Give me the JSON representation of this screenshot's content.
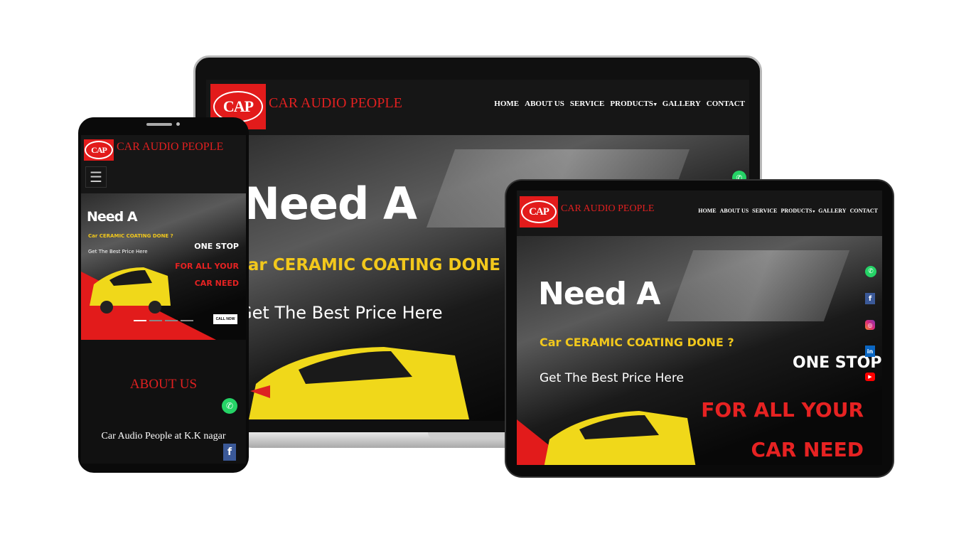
{
  "brand": {
    "name": "CAR AUDIO PEOPLE",
    "logo_text": "CAP"
  },
  "nav": {
    "items": [
      "HOME",
      "ABOUT US",
      "SERVICE",
      "PRODUCTS",
      "GALLERY",
      "CONTACT"
    ],
    "dropdown_item": "PRODUCTS"
  },
  "hero": {
    "headline": "Need A",
    "subtitle": "Car CERAMIC COATING DONE ?",
    "cta_text": "Get The Best Price Here",
    "side_top": "ONE STOP",
    "side_line1": "FOR ALL YOUR",
    "side_line2": "CAR NEED",
    "button": "CALL NOW"
  },
  "about": {
    "heading": "ABOUT US",
    "text": "Car Audio People at K.K nagar"
  },
  "social": [
    "whatsapp-icon",
    "facebook-icon",
    "instagram-icon",
    "linkedin-icon",
    "youtube-icon"
  ],
  "colors": {
    "brand_red": "#e21b1b",
    "accent_yellow": "#f2c81c",
    "dark_bg": "#0b0b0b",
    "header_bg": "#161616"
  }
}
